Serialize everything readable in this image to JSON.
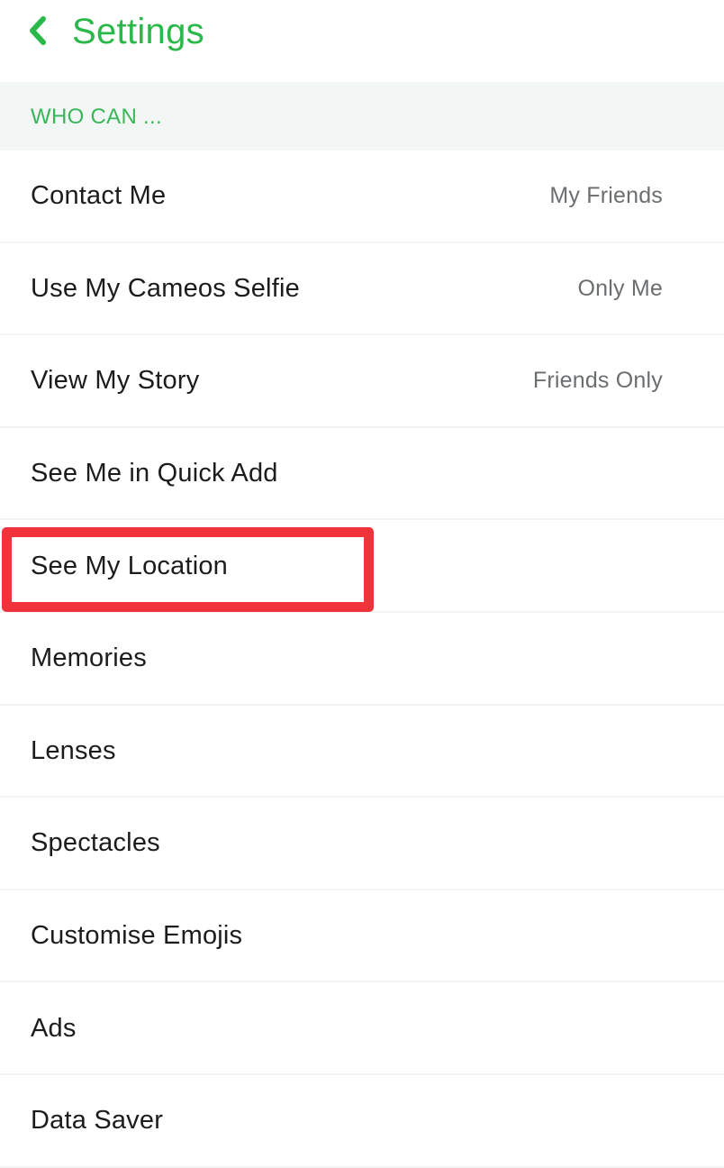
{
  "header": {
    "back_icon": "chevron-left-icon",
    "title": "Settings",
    "accent_color": "#2bb84a"
  },
  "section": {
    "title": "WHO CAN ..."
  },
  "items": [
    {
      "label": "Contact Me",
      "value": "My Friends"
    },
    {
      "label": "Use My Cameos Selfie",
      "value": "Only Me"
    },
    {
      "label": "View My Story",
      "value": "Friends Only"
    },
    {
      "label": "See Me in Quick Add",
      "value": ""
    },
    {
      "label": "See My Location",
      "value": "",
      "highlighted": true
    },
    {
      "label": "Memories",
      "value": ""
    },
    {
      "label": "Lenses",
      "value": ""
    },
    {
      "label": "Spectacles",
      "value": ""
    },
    {
      "label": "Customise Emojis",
      "value": ""
    },
    {
      "label": "Ads",
      "value": ""
    },
    {
      "label": "Data Saver",
      "value": ""
    }
  ],
  "annotation": {
    "highlight_color": "#f2333c",
    "highlighted_item": "See My Location"
  }
}
